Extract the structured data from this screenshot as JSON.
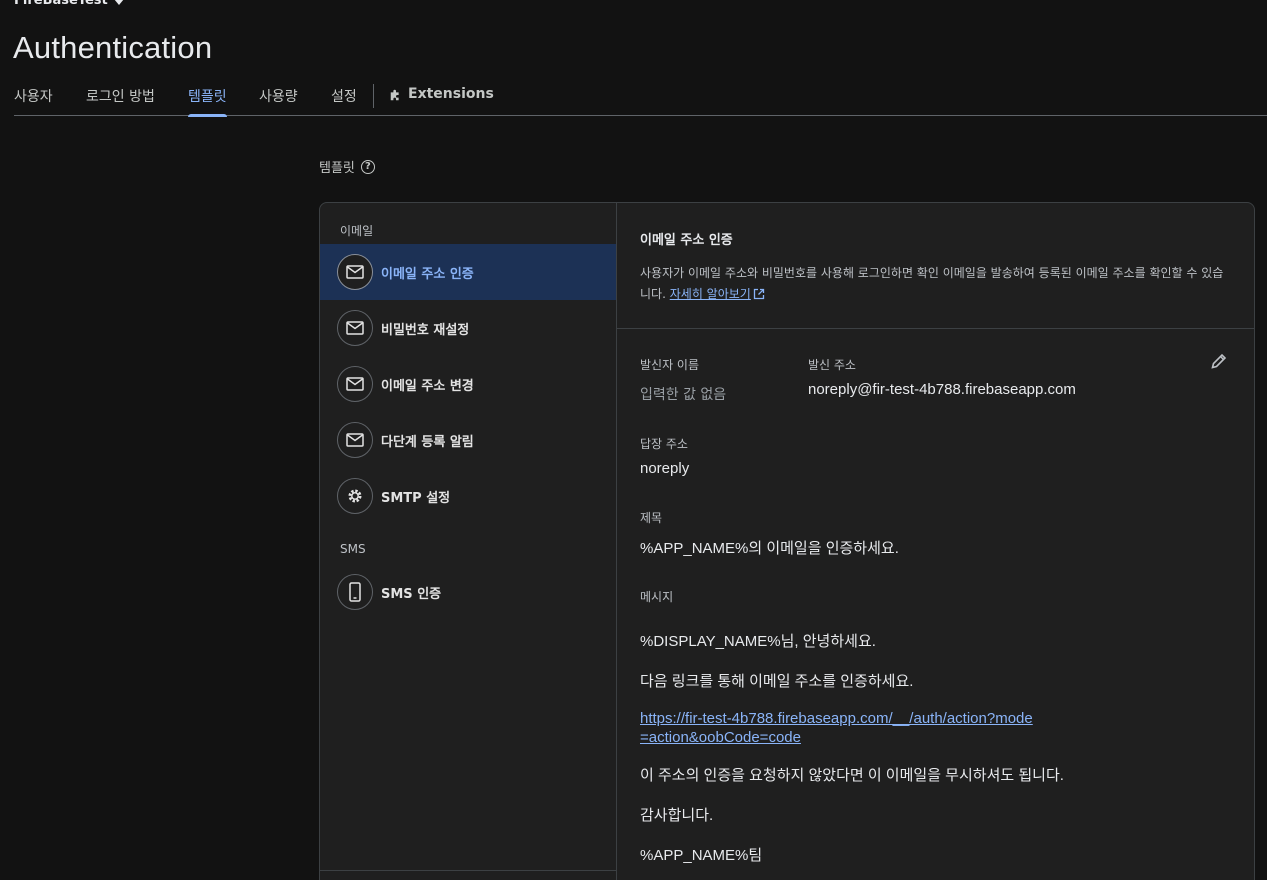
{
  "project": {
    "name": "FireBaseTest"
  },
  "page": {
    "title": "Authentication"
  },
  "tabs": [
    {
      "label": "사용자"
    },
    {
      "label": "로그인 방법"
    },
    {
      "label": "템플릿"
    },
    {
      "label": "사용량"
    },
    {
      "label": "설정"
    },
    {
      "label": "Extensions"
    }
  ],
  "section": {
    "title": "템플릿"
  },
  "sidebar": {
    "email_group": "이메일",
    "sms_group": "SMS",
    "items": [
      {
        "label": "이메일 주소 인증",
        "icon": "mail-icon"
      },
      {
        "label": "비밀번호 재설정",
        "icon": "mail-icon"
      },
      {
        "label": "이메일 주소 변경",
        "icon": "mail-icon"
      },
      {
        "label": "다단계 등록 알림",
        "icon": "mail-icon"
      },
      {
        "label": "SMTP 설정",
        "icon": "gear-icon"
      },
      {
        "label": "SMS 인증",
        "icon": "phone-icon"
      }
    ]
  },
  "detail": {
    "title": "이메일 주소 인증",
    "description": "사용자가 이메일 주소와 비밀번호를 사용해 로그인하면 확인 이메일을 발송하여 등록된 이메일 주소를 확인할 수 있습니다.",
    "learn_more": "자세히 알아보기",
    "sender_name_label": "발신자 이름",
    "sender_name_value": "입력한 값 없음",
    "from_label": "발신 주소",
    "from_value": "noreply@fir-test-4b788.firebaseapp.com",
    "reply_to_label": "답장 주소",
    "reply_to_value": "noreply",
    "subject_label": "제목",
    "subject_value": "%APP_NAME%의 이메일을 인증하세요.",
    "message_label": "메시지",
    "message": {
      "greeting": "%DISPLAY_NAME%님, 안녕하세요.",
      "instruction": "다음 링크를 통해 이메일 주소를 인증하세요.",
      "link": "https://fir-test-4b788.firebaseapp.com/__/auth/action?mode=action&oobCode=code",
      "ignore": "이 주소의 인증을 요청하지 않았다면 이 이메일을 무시하셔도 됩니다.",
      "thanks": "감사합니다.",
      "signature": "%APP_NAME%팀"
    }
  },
  "colors": {
    "accent": "#8ab4f8",
    "active_bg": "#1c3155",
    "background": "#121212",
    "card": "#1f1f1f"
  }
}
